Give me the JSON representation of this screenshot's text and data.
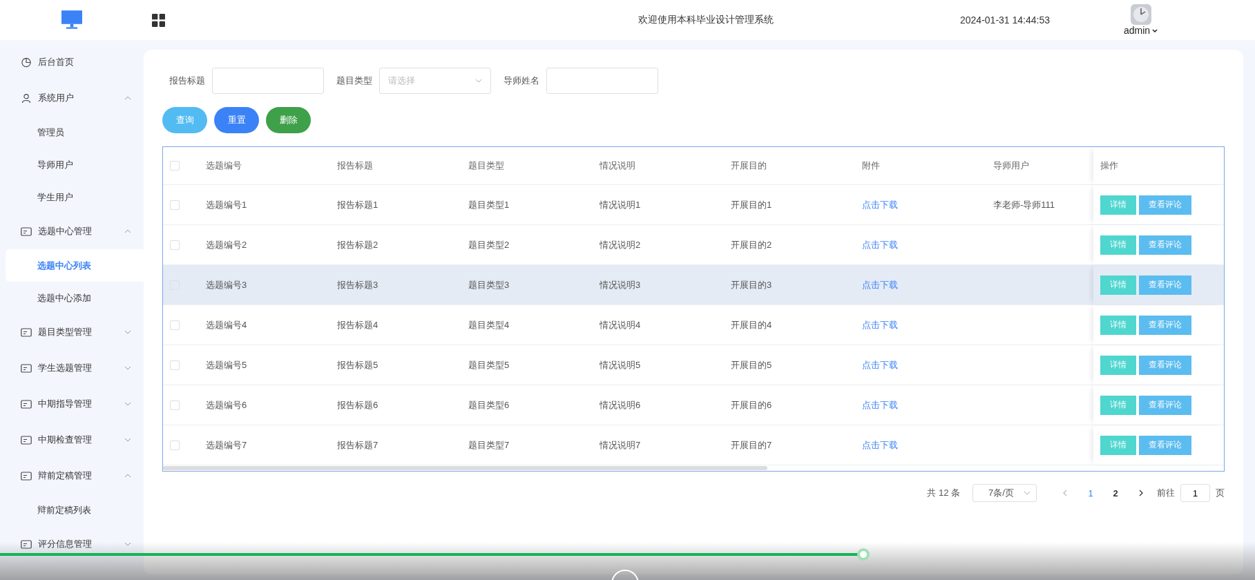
{
  "header": {
    "title": "欢迎使用本科毕业设计管理系统",
    "datetime": "2024-01-31 14:44:53",
    "user": "admin"
  },
  "sidebar": {
    "items": [
      {
        "label": "后台首页",
        "kind": "dashboard"
      },
      {
        "label": "系统用户",
        "kind": "users",
        "expanded": true,
        "children": [
          {
            "label": "管理员",
            "selected": false
          },
          {
            "label": "导师用户",
            "selected": false
          },
          {
            "label": "学生用户",
            "selected": false
          }
        ]
      },
      {
        "label": "选题中心管理",
        "kind": "module",
        "expanded": true,
        "children": [
          {
            "label": "选题中心列表",
            "selected": true
          },
          {
            "label": "选题中心添加",
            "selected": false
          }
        ]
      },
      {
        "label": "题目类型管理",
        "kind": "module",
        "expanded": false
      },
      {
        "label": "学生选题管理",
        "kind": "module",
        "expanded": false
      },
      {
        "label": "中期指导管理",
        "kind": "module",
        "expanded": false
      },
      {
        "label": "中期检查管理",
        "kind": "module",
        "expanded": false
      },
      {
        "label": "辩前定稿管理",
        "kind": "module",
        "expanded": true,
        "children": [
          {
            "label": "辩前定稿列表",
            "selected": false
          }
        ]
      },
      {
        "label": "评分信息管理",
        "kind": "module",
        "expanded": false
      }
    ]
  },
  "filters": [
    {
      "label": "报告标题",
      "kind": "text"
    },
    {
      "label": "题目类型",
      "kind": "select",
      "placeholder": "请选择"
    },
    {
      "label": "导师姓名",
      "kind": "text"
    }
  ],
  "actions": [
    {
      "label": "查询",
      "kind": "query"
    },
    {
      "label": "重置",
      "kind": "reset"
    },
    {
      "label": "删除",
      "kind": "delete"
    }
  ],
  "table": {
    "header_checked": false,
    "columns": [
      "选题编号",
      "报告标题",
      "题目类型",
      "情况说明",
      "开展目的",
      "附件",
      "导师用户",
      "操作"
    ],
    "rows": [
      {
        "checked": false,
        "hovered": false,
        "cells": [
          "选题编号1",
          "报告标题1",
          "题目类型1",
          "情况说明1",
          "开展目的1"
        ],
        "attachment": "点击下载",
        "teacher": "李老师-导师111",
        "buttons": [
          "详情",
          "查看评论"
        ]
      },
      {
        "checked": false,
        "hovered": false,
        "cells": [
          "选题编号2",
          "报告标题2",
          "题目类型2",
          "情况说明2",
          "开展目的2"
        ],
        "attachment": "点击下载",
        "buttons": [
          "详情",
          "查看评论"
        ]
      },
      {
        "checked": false,
        "hovered": true,
        "cells": [
          "选题编号3",
          "报告标题3",
          "题目类型3",
          "情况说明3",
          "开展目的3"
        ],
        "attachment": "点击下载",
        "buttons": [
          "详情",
          "查看评论"
        ]
      },
      {
        "checked": false,
        "hovered": false,
        "cells": [
          "选题编号4",
          "报告标题4",
          "题目类型4",
          "情况说明4",
          "开展目的4"
        ],
        "attachment": "点击下载",
        "buttons": [
          "详情",
          "查看评论"
        ]
      },
      {
        "checked": false,
        "hovered": false,
        "cells": [
          "选题编号5",
          "报告标题5",
          "题目类型5",
          "情况说明5",
          "开展目的5"
        ],
        "attachment": "点击下载",
        "buttons": [
          "详情",
          "查看评论"
        ]
      },
      {
        "checked": false,
        "hovered": false,
        "cells": [
          "选题编号6",
          "报告标题6",
          "题目类型6",
          "情况说明6",
          "开展目的6"
        ],
        "attachment": "点击下载",
        "buttons": [
          "详情",
          "查看评论"
        ]
      },
      {
        "checked": false,
        "hovered": false,
        "cells": [
          "选题编号7",
          "报告标题7",
          "题目类型7",
          "情况说明7",
          "开展目的7"
        ],
        "attachment": "点击下载",
        "buttons": [
          "详情",
          "查看评论"
        ]
      }
    ]
  },
  "pagination": {
    "total": "共 12 条",
    "page_size": "7条/页",
    "pages": [
      {
        "label": "1",
        "selected": true
      },
      {
        "label": "2",
        "selected": false
      }
    ],
    "goto_label": "前往",
    "goto_value": "1",
    "goto_suffix": "页"
  },
  "video_player": {
    "progress": {
      "level": 0.688
    }
  }
}
